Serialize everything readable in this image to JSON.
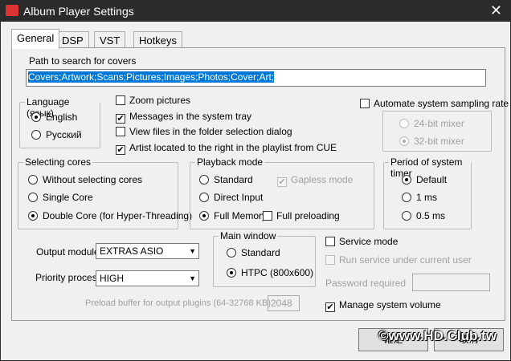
{
  "window": {
    "title": "Album Player Settings",
    "close": "✕"
  },
  "tabs": [
    "General",
    "DSP",
    "VST",
    "Hotkeys"
  ],
  "covers": {
    "label": "Path to search for covers",
    "value": "Covers;Artwork;Scans;Pictures;Images;Photos;Cover;Art;"
  },
  "language": {
    "title": "Language (язык)",
    "options": [
      "English",
      "Русский"
    ]
  },
  "checks": {
    "zoom": "Zoom pictures",
    "tray": "Messages in the system tray",
    "view": "View files in the folder selection dialog",
    "artist": "Artist located to the right in the playlist from CUE",
    "auto": "Automate system sampling rate"
  },
  "mixer": [
    "24-bit mixer",
    "32-bit mixer"
  ],
  "cores": {
    "title": "Selecting cores",
    "options": [
      "Without selecting cores",
      "Single Core",
      "Double Core (for Hyper-Threading)"
    ]
  },
  "playback": {
    "title": "Playback mode",
    "options": [
      "Standard",
      "Direct Input",
      "Full Memory"
    ],
    "gapless": "Gapless mode",
    "full_preloading": "Full preloading"
  },
  "timer": {
    "title": "Period of system timer",
    "options": [
      "Default",
      "1 ms",
      "0.5 ms"
    ]
  },
  "output": {
    "label": "Output module",
    "value": "EXTRAS ASIO"
  },
  "priority": {
    "label": "Priority process",
    "value": "HIGH"
  },
  "preload": {
    "label": "Preload buffer for output plugins (64-32768 KB)",
    "value": "2048"
  },
  "main_window": {
    "title": "Main window",
    "options": [
      "Standard",
      "HTPC (800x600)"
    ]
  },
  "service": {
    "mode": "Service mode",
    "run": "Run service under current user",
    "password": "Password required",
    "manage": "Manage system volume"
  },
  "buttons": {
    "ok": "確定",
    "cancel": "取消"
  },
  "watermark": "©www.HD.Club.tw"
}
